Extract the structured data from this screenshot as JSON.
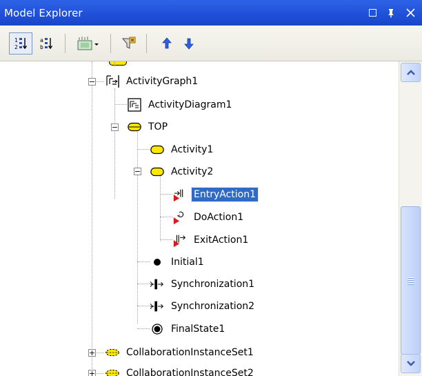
{
  "window": {
    "title": "Model Explorer"
  },
  "toolbar": {
    "buttons": [
      {
        "name": "sort-by-type-icon"
      },
      {
        "name": "sort-alphabetical-icon"
      },
      {
        "name": "new-element-dropdown-icon"
      },
      {
        "name": "filter-icon"
      },
      {
        "name": "move-up-icon"
      },
      {
        "name": "move-down-icon"
      }
    ]
  },
  "tree": {
    "nodes": [
      {
        "label": "ActivityGraph1",
        "icon": "activity-graph-icon"
      },
      {
        "label": "ActivityDiagram1",
        "icon": "diagram-icon"
      },
      {
        "label": "TOP",
        "icon": "state-icon"
      },
      {
        "label": "Activity1",
        "icon": "state-icon"
      },
      {
        "label": "Activity2",
        "icon": "state-icon"
      },
      {
        "label": "EntryAction1",
        "icon": "entry-action-icon",
        "selected": true
      },
      {
        "label": "DoAction1",
        "icon": "do-action-icon"
      },
      {
        "label": "ExitAction1",
        "icon": "exit-action-icon"
      },
      {
        "label": "Initial1",
        "icon": "initial-state-icon"
      },
      {
        "label": "Synchronization1",
        "icon": "synchronization-icon"
      },
      {
        "label": "Synchronization2",
        "icon": "synchronization-icon"
      },
      {
        "label": "FinalState1",
        "icon": "final-state-icon"
      },
      {
        "label": "CollaborationInstanceSet1",
        "icon": "collaboration-icon"
      },
      {
        "label": "CollaborationInstanceSet2",
        "icon": "collaboration-icon"
      }
    ]
  },
  "colors": {
    "titlebar": "#1f4fd8",
    "selection": "#316ac5",
    "state_fill": "#ffe800"
  }
}
